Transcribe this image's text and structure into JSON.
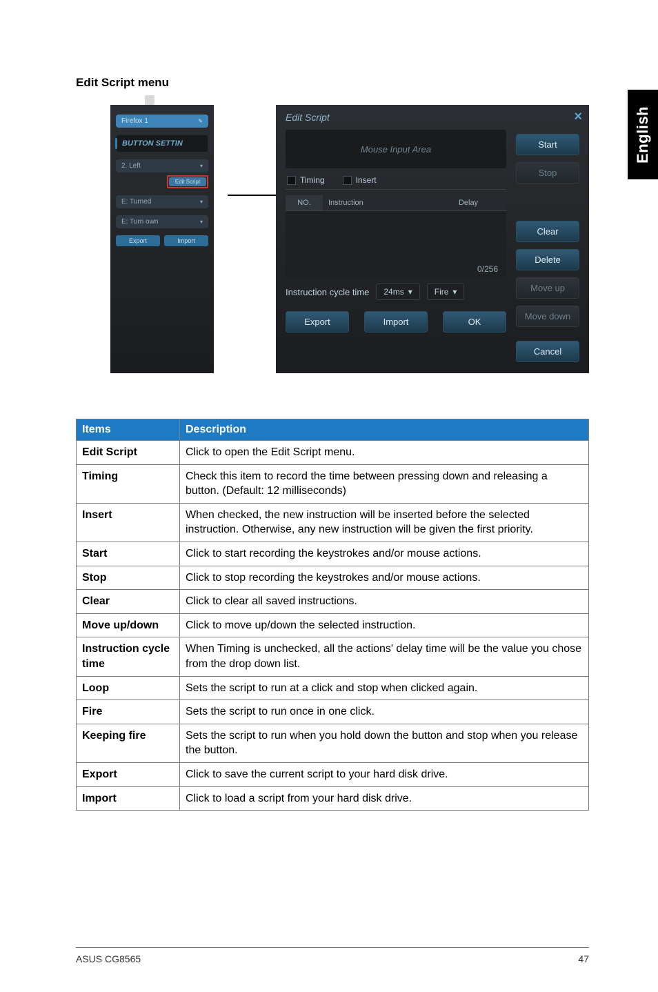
{
  "side_tab": "English",
  "heading": "Edit Script menu",
  "left_panel": {
    "pill1": "Firefox 1",
    "button_setting": "BUTTON SETTIN",
    "pill2": "2. Left",
    "highlight_btn": "Edit Script",
    "pill3": "E: Turned",
    "pill4": "E: Turn own",
    "mini_export": "Export",
    "mini_import": "Import"
  },
  "dialog": {
    "title": "Edit Script",
    "close_icon": "×",
    "mouse_area": "Mouse Input Area",
    "timing": "Timing",
    "insert": "Insert",
    "col_no": "NO.",
    "col_instruction": "Instruction",
    "col_delay": "Delay",
    "counter": "0/256",
    "cycle_label": "Instruction cycle time",
    "cycle_value": "24ms",
    "fire_label": "Fire",
    "btn_start": "Start",
    "btn_stop": "Stop",
    "btn_clear": "Clear",
    "btn_delete": "Delete",
    "btn_moveup": "Move up",
    "btn_movedown": "Move down",
    "btn_export": "Export",
    "btn_import": "Import",
    "btn_ok": "OK",
    "btn_cancel": "Cancel"
  },
  "table": {
    "header_items": "Items",
    "header_desc": "Description",
    "rows": [
      {
        "item": "Edit Script",
        "desc": "Click to open the Edit Script menu."
      },
      {
        "item": "Timing",
        "desc": "Check this item to record the time between pressing down and releasing a button. (Default: 12 milliseconds)"
      },
      {
        "item": "Insert",
        "desc": "When checked, the new instruction will be inserted before the selected instruction. Otherwise, any new instruction will be given the first priority."
      },
      {
        "item": "Start",
        "desc": "Click to start recording the keystrokes and/or mouse actions."
      },
      {
        "item": "Stop",
        "desc": "Click to stop recording the keystrokes and/or mouse actions."
      },
      {
        "item": "Clear",
        "desc": "Click to clear all saved instructions."
      },
      {
        "item": "Move up/down",
        "desc": "Click to move up/down the selected instruction."
      },
      {
        "item": "Instruction cycle time",
        "desc": "When Timing is unchecked, all the actions' delay time will be the value you chose from the drop down list."
      },
      {
        "item": "Loop",
        "desc": "Sets the script to run at a click and stop when clicked again."
      },
      {
        "item": "Fire",
        "desc": "Sets the script to run once in one click."
      },
      {
        "item": "Keeping fire",
        "desc": "Sets the script to run when you hold down the button and stop when you release the button."
      },
      {
        "item": "Export",
        "desc": "Click to save the current script to your hard disk drive."
      },
      {
        "item": "Import",
        "desc": "Click to load a script from your hard disk drive."
      }
    ]
  },
  "footer": {
    "left": "ASUS CG8565",
    "right": "47"
  }
}
